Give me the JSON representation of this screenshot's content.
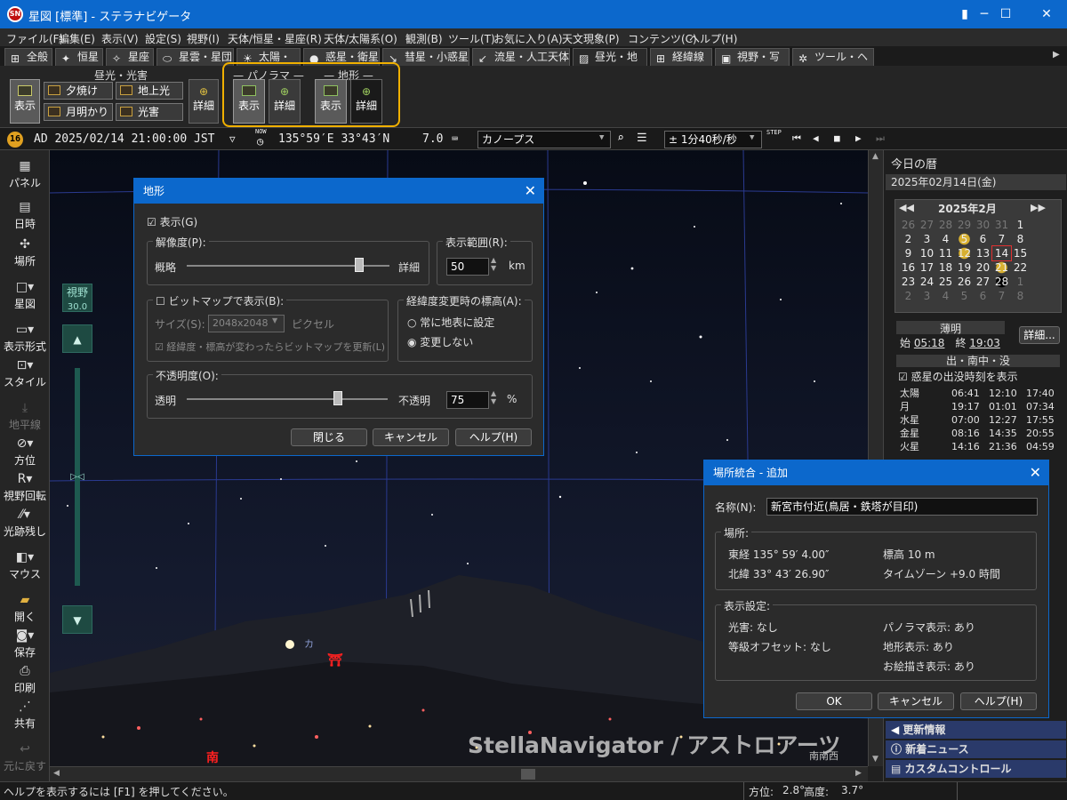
{
  "window": {
    "title": "星図 [標準] - ステラナビゲータ",
    "app_icon": "SN"
  },
  "menu": [
    "ファイル(F)",
    "編集(E)",
    "表示(V)",
    "設定(S)",
    "視野(I)",
    "天体/恒星・星座(R)",
    "天体/太陽系(O)",
    "観測(B)",
    "ツール(T)",
    "お気に入り(A)",
    "天文現象(P)",
    "コンテンツ(C)",
    "ヘルプ(H)"
  ],
  "tabs": [
    "全般",
    "恒星",
    "星座",
    "星雲・星団",
    "太陽・月",
    "惑星・衛星",
    "彗星・小惑星",
    "流星・人工天体",
    "昼光・地形",
    "経緯線",
    "視野・写野",
    "ツール・ヘルプ"
  ],
  "ribbon": {
    "daylight_group": "昼光・光害",
    "show": "表示",
    "sunset": "夕焼け",
    "earthlight": "地上光",
    "moonlight": "月明かり",
    "light_pollution": "光害",
    "detail": "詳細",
    "panorama_group": "パノラマ",
    "terrain_group": "地形"
  },
  "timebar": {
    "badge": "16",
    "datetime": "AD 2025/02/14 21:00:00 JST",
    "now": "NOW",
    "coords": "135°59′E 33°43′N",
    "mag": "7.0",
    "target": "カノープス",
    "step": "± 1分40秒/秒",
    "step_label": "STEP"
  },
  "left_toolbar": [
    "パネル",
    "日時",
    "場所",
    "星図",
    "表示形式",
    "スタイル",
    "地平線",
    "方位",
    "視野回転",
    "光跡残し",
    "マウス",
    "開く",
    "保存",
    "印刷",
    "共有",
    "元に戻す"
  ],
  "fov": {
    "label": "視野",
    "value": "30.0"
  },
  "sky": {
    "direction_s": "南",
    "direction_ssw": "南南西",
    "watermark": "StellaNavigator / アストロアーツ",
    "partial_label": "カ"
  },
  "terrain_dialog": {
    "title": "地形",
    "show": "表示(G)",
    "resolution": "解像度(P):",
    "coarse": "概略",
    "detail": "詳細",
    "range": "表示範囲(R):",
    "range_value": "50",
    "range_unit": "km",
    "bitmap": "ビットマップで表示(B):",
    "size_label": "サイズ(S):",
    "size_value": "2048x2048",
    "pixel": "ピクセル",
    "update_bitmap": "経緯度・標高が変わったらビットマップを更新(L)",
    "elev_group": "経緯度変更時の標高(A):",
    "always": "常に地表に設定",
    "nochange": "変更しない",
    "opacity": "不透明度(O):",
    "transparent": "透明",
    "opaque": "不透明",
    "opacity_value": "75",
    "pct": "%",
    "close": "閉じる",
    "cancel": "キャンセル",
    "help": "ヘルプ(H)",
    "resolution_level": 0.85,
    "opacity_level": 0.75
  },
  "today": {
    "title": "今日の暦",
    "date": "2025年02月14日(金)",
    "month": "2025年2月",
    "weeks": [
      [
        "26",
        "27",
        "28",
        "29",
        "30",
        "31",
        "1"
      ],
      [
        "2",
        "3",
        "4",
        "5",
        "6",
        "7",
        "8"
      ],
      [
        "9",
        "10",
        "11",
        "12",
        "13",
        "14",
        "15"
      ],
      [
        "16",
        "17",
        "18",
        "19",
        "20",
        "21",
        "22"
      ],
      [
        "23",
        "24",
        "25",
        "26",
        "27",
        "28",
        "1"
      ],
      [
        "2",
        "3",
        "4",
        "5",
        "6",
        "7",
        "8"
      ]
    ],
    "twilight": "薄明",
    "start": "始",
    "start_time": "05:18",
    "end": "終",
    "end_time": "19:03",
    "detail_btn": "詳細...",
    "rise_set": "出・南中・没",
    "planet_check": "惑星の出没時刻を表示",
    "rows": [
      [
        "太陽",
        "06:41",
        "12:10",
        "17:40"
      ],
      [
        "月",
        "19:17",
        "01:01",
        "07:34"
      ],
      [
        "水星",
        "07:00",
        "12:27",
        "17:55"
      ],
      [
        "金星",
        "08:16",
        "14:35",
        "20:55"
      ],
      [
        "火星",
        "14:16",
        "21:36",
        "04:59"
      ]
    ],
    "news1": "更新情報",
    "news2": "新着ニュース",
    "news3": "カスタムコントロール"
  },
  "place_dialog": {
    "title": "場所統合 - 追加",
    "name_label": "名称(N):",
    "name_value": "新宮市付近(鳥居・鉄塔が目印)",
    "place": "場所:",
    "lon": "東経 135° 59′ 4.00″",
    "lat": "北緯 33° 43′ 26.90″",
    "elev": "標高 10 m",
    "tz": "タイムゾーン +9.0 時間",
    "disp": "表示設定:",
    "lp": "光害: なし",
    "offset": "等級オフセット: なし",
    "pano": "パノラマ表示: あり",
    "terrain": "地形表示: あり",
    "drawing": "お絵描き表示: あり",
    "ok": "OK",
    "cancel": "キャンセル",
    "help": "ヘルプ(H)"
  },
  "status": {
    "help": "ヘルプを表示するには [F1] を押してください。",
    "az": "方位:",
    "az_val": "2.8°",
    "alt": "高度:",
    "alt_val": "3.7°"
  }
}
